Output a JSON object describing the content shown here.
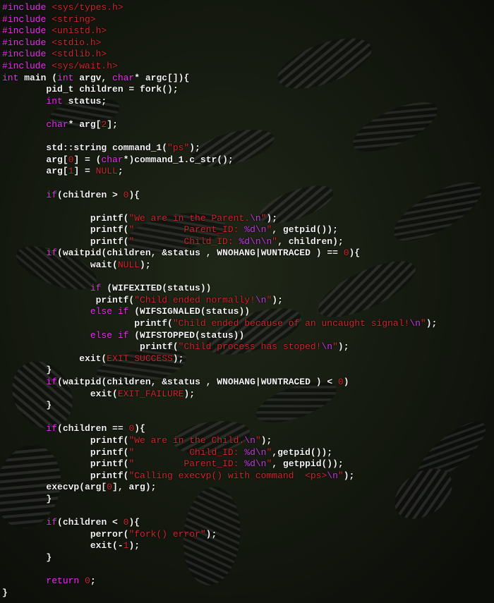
{
  "background": {
    "subject": "zebra-herd-photo",
    "colors": {
      "grass": "#26321c",
      "stripe_light": "#5a5a5a",
      "stripe_dark": "#0c0c0c"
    }
  },
  "colors": {
    "plain": "#f2f2f2",
    "keyword": "#f02ff2",
    "string": "#d0282e",
    "number": "#d0282e",
    "escape": "#c93ae8"
  },
  "lines": [
    [
      [
        "kw",
        "#include "
      ],
      [
        "str",
        "<sys/types.h>"
      ]
    ],
    [
      [
        "kw",
        "#include "
      ],
      [
        "str",
        "<string>"
      ]
    ],
    [
      [
        "kw",
        "#include "
      ],
      [
        "str",
        "<unistd.h>"
      ]
    ],
    [
      [
        "kw",
        "#include "
      ],
      [
        "str",
        "<stdio.h>"
      ]
    ],
    [
      [
        "kw",
        "#include "
      ],
      [
        "str",
        "<stdlib.h>"
      ]
    ],
    [
      [
        "kw",
        "#include "
      ],
      [
        "str",
        "<sys/wait.h>"
      ]
    ],
    [
      [
        "kw",
        "int"
      ],
      [
        "pl",
        " main ("
      ],
      [
        "kw",
        "int"
      ],
      [
        "pl",
        " argv, "
      ],
      [
        "kw",
        "char"
      ],
      [
        "pl",
        "* argc[]){"
      ]
    ],
    [
      [
        "pl",
        "        pid_t children = fork();"
      ]
    ],
    [
      [
        "pl",
        "        "
      ],
      [
        "kw",
        "int"
      ],
      [
        "pl",
        " status;"
      ]
    ],
    [
      [
        "pl",
        ""
      ]
    ],
    [
      [
        "pl",
        "        "
      ],
      [
        "kw",
        "char"
      ],
      [
        "pl",
        "* arg["
      ],
      [
        "num",
        "2"
      ],
      [
        "pl",
        "];"
      ]
    ],
    [
      [
        "pl",
        ""
      ]
    ],
    [
      [
        "pl",
        "        std::string command_1("
      ],
      [
        "str",
        "\"ps\""
      ],
      [
        "pl",
        ");"
      ]
    ],
    [
      [
        "pl",
        "        arg["
      ],
      [
        "num",
        "0"
      ],
      [
        "pl",
        "] = ("
      ],
      [
        "kw",
        "char"
      ],
      [
        "pl",
        "*)command_1.c_str();"
      ]
    ],
    [
      [
        "pl",
        "        arg["
      ],
      [
        "num",
        "1"
      ],
      [
        "pl",
        "] = "
      ],
      [
        "num",
        "NULL"
      ],
      [
        "pl",
        ";"
      ]
    ],
    [
      [
        "pl",
        ""
      ]
    ],
    [
      [
        "pl",
        "        "
      ],
      [
        "kw",
        "if"
      ],
      [
        "pl",
        "(children > "
      ],
      [
        "num",
        "0"
      ],
      [
        "pl",
        "){"
      ]
    ],
    [
      [
        "pl",
        ""
      ]
    ],
    [
      [
        "pl",
        "                printf("
      ],
      [
        "str",
        "\"We are in the Parent."
      ],
      [
        "esc",
        "\\n"
      ],
      [
        "str",
        "\""
      ],
      [
        "pl",
        ");"
      ]
    ],
    [
      [
        "pl",
        "                printf("
      ],
      [
        "str",
        "\"         Parent_ID: "
      ],
      [
        "esc",
        "%d\\n"
      ],
      [
        "str",
        "\""
      ],
      [
        "pl",
        ", getpid());"
      ]
    ],
    [
      [
        "pl",
        "                printf("
      ],
      [
        "str",
        "\"         Child_ID: "
      ],
      [
        "esc",
        "%d\\n\\n"
      ],
      [
        "str",
        "\""
      ],
      [
        "pl",
        ", children);"
      ]
    ],
    [
      [
        "pl",
        "        "
      ],
      [
        "kw",
        "if"
      ],
      [
        "pl",
        "(waitpid(children, &status , WNOHANG"
      ],
      [
        "cr",
        "|"
      ],
      [
        "pl",
        "WUNTRACED ) == "
      ],
      [
        "num",
        "0"
      ],
      [
        "pl",
        "){"
      ]
    ],
    [
      [
        "pl",
        "                wait("
      ],
      [
        "num",
        "NULL"
      ],
      [
        "pl",
        ");"
      ]
    ],
    [
      [
        "pl",
        ""
      ]
    ],
    [
      [
        "pl",
        "                "
      ],
      [
        "kw",
        "if"
      ],
      [
        "pl",
        " (WIFEXITED(status))"
      ]
    ],
    [
      [
        "pl",
        "                 printf("
      ],
      [
        "str",
        "\"Child ended normally!"
      ],
      [
        "esc",
        "\\n"
      ],
      [
        "str",
        "\""
      ],
      [
        "pl",
        ");"
      ]
    ],
    [
      [
        "pl",
        "                "
      ],
      [
        "kw",
        "else if"
      ],
      [
        "pl",
        " (WIFSIGNALED(status))"
      ]
    ],
    [
      [
        "pl",
        "                        printf("
      ],
      [
        "str",
        "\"Child ended because of an uncaught signal!"
      ],
      [
        "esc",
        "\\n"
      ],
      [
        "str",
        "\""
      ],
      [
        "pl",
        ");"
      ]
    ],
    [
      [
        "pl",
        "                "
      ],
      [
        "kw",
        "else if"
      ],
      [
        "pl",
        " (WIFSTOPPED(status))"
      ]
    ],
    [
      [
        "pl",
        "                         printf("
      ],
      [
        "str",
        "\"Child process has stoped!"
      ],
      [
        "esc",
        "\\n"
      ],
      [
        "str",
        "\""
      ],
      [
        "pl",
        ");"
      ]
    ],
    [
      [
        "pl",
        "              exit("
      ],
      [
        "num",
        "EXIT_SUCCESS"
      ],
      [
        "pl",
        ");"
      ]
    ],
    [
      [
        "pl",
        "        }"
      ]
    ],
    [
      [
        "pl",
        "        "
      ],
      [
        "kw",
        "if"
      ],
      [
        "pl",
        "(waitpid(children, &status , WNOHANG"
      ],
      [
        "cr",
        "|"
      ],
      [
        "pl",
        "WUNTRACED ) < "
      ],
      [
        "num",
        "0"
      ],
      [
        "pl",
        ")"
      ]
    ],
    [
      [
        "pl",
        "                exit("
      ],
      [
        "num",
        "EXIT_FAILURE"
      ],
      [
        "pl",
        ");"
      ]
    ],
    [
      [
        "pl",
        "        }"
      ]
    ],
    [
      [
        "pl",
        ""
      ]
    ],
    [
      [
        "pl",
        "        "
      ],
      [
        "kw",
        "if"
      ],
      [
        "pl",
        "(children == "
      ],
      [
        "num",
        "0"
      ],
      [
        "pl",
        "){"
      ]
    ],
    [
      [
        "pl",
        "                printf("
      ],
      [
        "str",
        "\"We are in the Child."
      ],
      [
        "esc",
        "\\n"
      ],
      [
        "str",
        "\""
      ],
      [
        "pl",
        ");"
      ]
    ],
    [
      [
        "pl",
        "                printf("
      ],
      [
        "str",
        "\"          Child_ID: "
      ],
      [
        "esc",
        "%d\\n"
      ],
      [
        "str",
        "\""
      ],
      [
        "pl",
        ",getpid());"
      ]
    ],
    [
      [
        "pl",
        "                printf("
      ],
      [
        "str",
        "\"         Parent_ID: "
      ],
      [
        "esc",
        "%d\\n"
      ],
      [
        "str",
        "\""
      ],
      [
        "pl",
        ", getppid());"
      ]
    ],
    [
      [
        "pl",
        "                printf("
      ],
      [
        "str",
        "\"Calling execvp() with command  <ps>"
      ],
      [
        "esc",
        "\\n"
      ],
      [
        "str",
        "\""
      ],
      [
        "pl",
        ");"
      ]
    ],
    [
      [
        "pl",
        "        execvp(arg["
      ],
      [
        "num",
        "0"
      ],
      [
        "pl",
        "], arg);"
      ]
    ],
    [
      [
        "pl",
        "        }"
      ]
    ],
    [
      [
        "pl",
        ""
      ]
    ],
    [
      [
        "pl",
        "        "
      ],
      [
        "kw",
        "if"
      ],
      [
        "pl",
        "(children < "
      ],
      [
        "num",
        "0"
      ],
      [
        "pl",
        "){"
      ]
    ],
    [
      [
        "pl",
        "                perror("
      ],
      [
        "str",
        "\"fork() error\""
      ],
      [
        "pl",
        ");"
      ]
    ],
    [
      [
        "pl",
        "                exit(-"
      ],
      [
        "num",
        "1"
      ],
      [
        "pl",
        ");"
      ]
    ],
    [
      [
        "pl",
        "        }"
      ]
    ],
    [
      [
        "pl",
        ""
      ]
    ],
    [
      [
        "pl",
        "        "
      ],
      [
        "kw",
        "return"
      ],
      [
        "pl",
        " "
      ],
      [
        "num",
        "0"
      ],
      [
        "pl",
        ";"
      ]
    ],
    [
      [
        "pl",
        "}"
      ]
    ]
  ]
}
